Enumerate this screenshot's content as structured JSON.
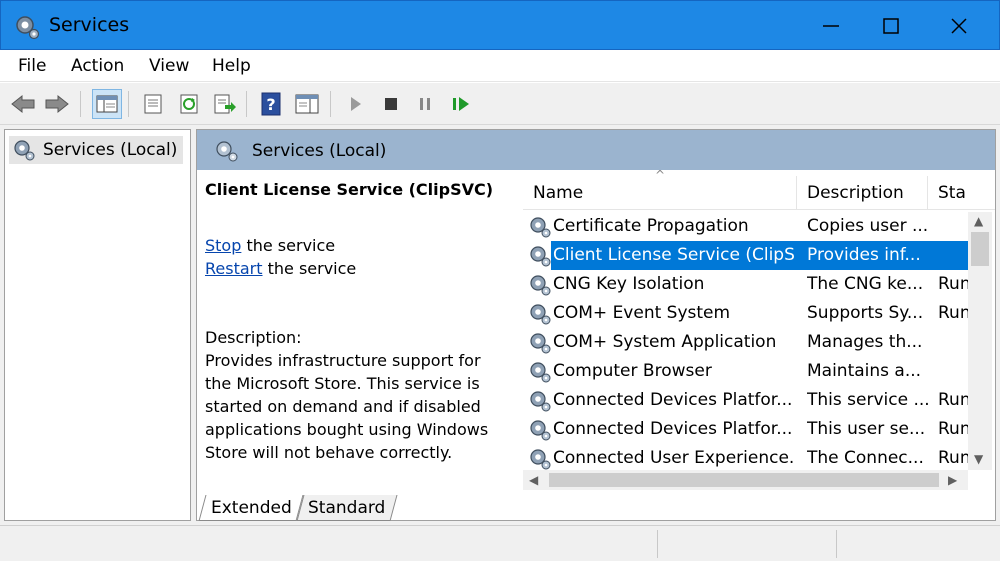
{
  "window": {
    "title": "Services"
  },
  "menu": [
    "File",
    "Action",
    "View",
    "Help"
  ],
  "toolbar": {
    "buttons": [
      "back-icon",
      "forward-icon",
      "show-hide-tree-icon",
      "properties-icon",
      "refresh-icon",
      "export-list-icon",
      "help-icon",
      "show-hide-action-pane-icon",
      "start-service-icon",
      "stop-service-icon",
      "pause-service-icon",
      "restart-service-icon"
    ]
  },
  "tree": {
    "root_label": "Services (Local)"
  },
  "pane": {
    "header_title": "Services (Local)"
  },
  "detail": {
    "service_name": "Client License Service (ClipSVC)",
    "stop_link": "Stop",
    "stop_suffix": " the service",
    "restart_link": "Restart",
    "restart_suffix": " the service",
    "description_label": "Description:",
    "description_text": "Provides infrastructure support for the Microsoft Store. This service is started on demand and if disabled applications bought using Windows Store will not behave correctly."
  },
  "list": {
    "columns": [
      "Name",
      "Description",
      "Sta"
    ],
    "rows": [
      {
        "name": "Certificate Propagation",
        "description": "Copies user ...",
        "status": ""
      },
      {
        "name": "Client License Service (ClipS...",
        "description": "Provides inf...",
        "status": ""
      },
      {
        "name": "CNG Key Isolation",
        "description": "The CNG ke...",
        "status": "Run"
      },
      {
        "name": "COM+ Event System",
        "description": "Supports Sy...",
        "status": "Run"
      },
      {
        "name": "COM+ System Application",
        "description": "Manages th...",
        "status": ""
      },
      {
        "name": "Computer Browser",
        "description": "Maintains a...",
        "status": ""
      },
      {
        "name": "Connected Devices Platfor...",
        "description": "This service ...",
        "status": "Run"
      },
      {
        "name": "Connected Devices Platfor...",
        "description": "This user se...",
        "status": "Run"
      },
      {
        "name": "Connected User Experience...",
        "description": "The Connec...",
        "status": "Run"
      }
    ],
    "selected_index": 1
  },
  "tabs": [
    "Extended",
    "Standard"
  ],
  "colors": {
    "titlebar": "#1e88e5",
    "selection": "#0078d7",
    "pane_header": "#9bb4cf",
    "link": "#0645ad"
  }
}
